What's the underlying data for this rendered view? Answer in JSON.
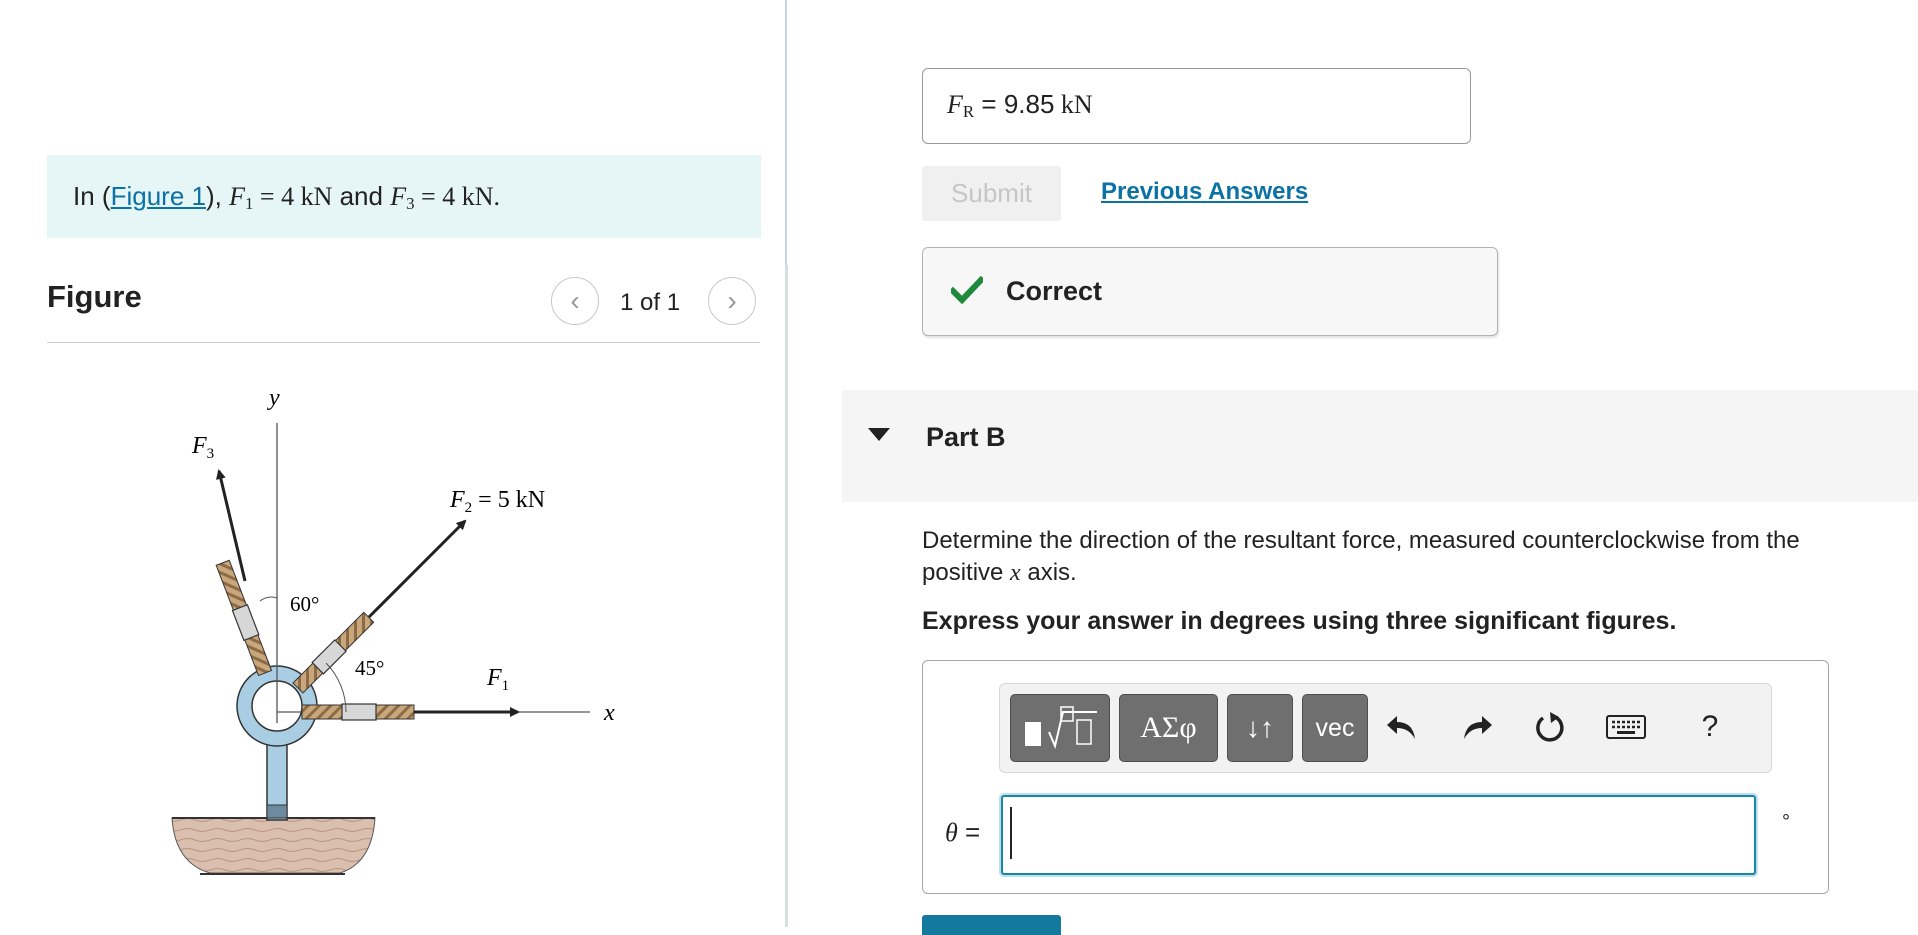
{
  "problem": {
    "intro_prefix": "In (",
    "figure_link": "Figure 1",
    "intro_after_link": "), ",
    "f1_symbol": "F",
    "f1_subscript": "1",
    "f1_value": " = 4 kN",
    "conjunction": " and ",
    "f3_symbol": "F",
    "f3_subscript": "3",
    "f3_value": " = 4 kN."
  },
  "figure_panel": {
    "title": "Figure",
    "counter": "1 of 1",
    "prev_icon": "chevron-left-icon",
    "next_icon": "chevron-right-icon",
    "labels": {
      "y_axis": "y",
      "x_axis": "x",
      "f3": "F",
      "f3_sub": "3",
      "f2": "F",
      "f2_sub": "2",
      "f2_value": " = 5 kN",
      "f1": "F",
      "f1_sub": "1",
      "angle_60": "60°",
      "angle_45": "45°"
    }
  },
  "part_a": {
    "answer_symbol": "F",
    "answer_subscript": "R",
    "answer_eq": " = ",
    "answer_value": "9.85",
    "answer_unit": " kN",
    "submit_label": "Submit",
    "previous_answers_label": "Previous Answers",
    "feedback_label": "Correct",
    "feedback_icon": "checkmark-icon",
    "feedback_color": "#1f8a3b"
  },
  "part_b": {
    "title": "Part B",
    "caret_icon": "triangle-down-icon",
    "question_prefix": "Determine the direction of the resultant force, measured counterclockwise from the positive ",
    "question_var": "x",
    "question_suffix": " axis.",
    "instruction": "Express your answer in degrees using three significant figures.",
    "toolbar": {
      "templates_icon": "fraction-sqrt-template-icon",
      "greek_label": "ΑΣφ",
      "arrows_label": "↓↑",
      "vec_label": "vec",
      "undo_icon": "undo-icon",
      "redo_icon": "redo-icon",
      "reset_icon": "reset-icon",
      "keyboard_icon": "keyboard-icon",
      "help_label": "?"
    },
    "input_label": "θ",
    "input_eq": " =",
    "input_value": "",
    "unit": "°"
  },
  "colors": {
    "link": "#0c72a6",
    "intro_bg": "#e6f5f5",
    "input_border": "#1887a6"
  }
}
